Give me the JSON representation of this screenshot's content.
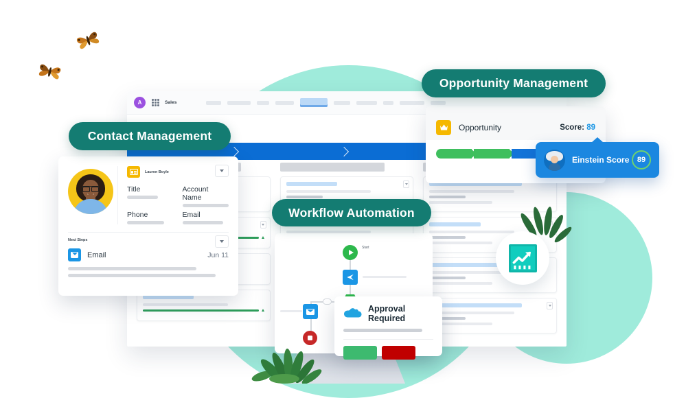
{
  "labels": {
    "contact_management": "Contact Management",
    "workflow_automation": "Workflow Automation",
    "opportunity_management": "Opportunity Management"
  },
  "nav": {
    "avatar_initial": "A",
    "app_name": "Sales",
    "app_launcher_icon": "grid-icon",
    "tab_count": 9,
    "active_tab_index": 4
  },
  "contact_card": {
    "person_name": "Lauren Boyle",
    "contact_icon": "contact-card-icon",
    "dropdown_icon": "chevron-down-icon",
    "fields": [
      {
        "label": "Title"
      },
      {
        "label": "Account Name"
      },
      {
        "label": "Phone"
      },
      {
        "label": "Email"
      }
    ],
    "next_steps_label": "Next Steps",
    "task": {
      "icon": "email-icon",
      "name": "Email",
      "date": "Jun 11"
    }
  },
  "opportunity_card": {
    "icon": "crown-icon",
    "title": "Opportunity",
    "score_label": "Score:",
    "score_value": "89",
    "path_stages": [
      {
        "state": "complete",
        "color": "#3FBF5E"
      },
      {
        "state": "complete",
        "color": "#3FBF5E"
      },
      {
        "state": "current",
        "color": "#1273D8"
      },
      {
        "state": "upcoming",
        "color": "#BFC4CB"
      }
    ]
  },
  "einstein_badge": {
    "avatar_icon": "einstein-avatar-icon",
    "label": "Einstein Score",
    "score": "89",
    "ring_color": "#6FD36F",
    "background": "#1B87E0"
  },
  "workflow_card": {
    "start_label": "Start",
    "nodes": [
      {
        "name": "start-node",
        "icon": "play-icon"
      },
      {
        "name": "send-node",
        "icon": "send-icon"
      },
      {
        "name": "decision-node",
        "icon": "lock-icon"
      },
      {
        "name": "email-node",
        "icon": "email-icon"
      },
      {
        "name": "stop-node",
        "icon": "stop-icon"
      }
    ]
  },
  "approval_popup": {
    "icon": "salesforce-cloud-icon",
    "title": "Approval Required",
    "approve_label": "",
    "reject_label": ""
  },
  "chart_badge": {
    "icon": "trending-up-chart-icon",
    "color": "#12CDBE"
  },
  "colors": {
    "pill_teal": "#147C72",
    "mint": "#9FEBDB",
    "salesforce_blue": "#0B6DD4",
    "accent_yellow": "#F5B800",
    "green": "#3DBA6F",
    "red": "#C00000"
  },
  "decor": {
    "butterflies": 2,
    "fronds": 2
  },
  "board": {
    "columns": [
      {
        "cards": [
          {
            "title_width": "42%",
            "has_menu": false,
            "has_progress": false
          },
          {
            "title_width": "42%",
            "has_menu": true,
            "has_progress": true
          },
          {
            "title_width": "42%",
            "has_menu": false,
            "has_progress": false
          },
          {
            "title_width": "42%",
            "has_menu": false,
            "has_progress": true
          }
        ]
      },
      {
        "cards": [
          {
            "title_width": "42%",
            "has_menu": true,
            "has_progress": false
          },
          {
            "title_width": "42%",
            "has_menu": false,
            "has_progress": false
          },
          {
            "title_width": "42%",
            "has_menu": false,
            "has_progress": false
          }
        ]
      },
      {
        "cards": [
          {
            "title_width": "76%",
            "has_menu": false,
            "has_progress": false
          },
          {
            "title_width": "42%",
            "has_menu": true,
            "has_progress": false
          },
          {
            "title_width": "76%",
            "has_menu": false,
            "has_progress": false
          },
          {
            "title_width": "76%",
            "has_menu": true,
            "has_progress": false
          }
        ]
      }
    ]
  }
}
